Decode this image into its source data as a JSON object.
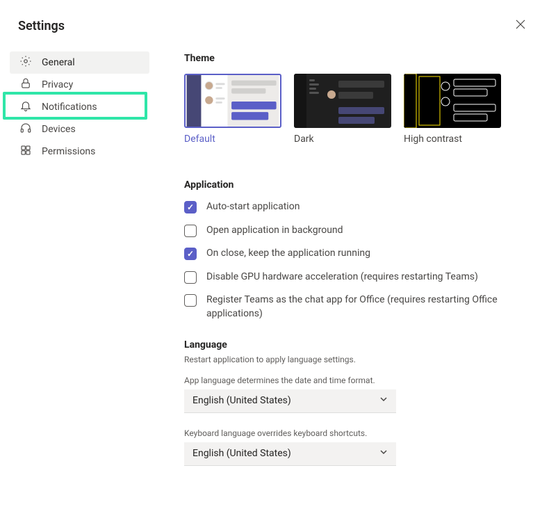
{
  "title": "Settings",
  "sidebar": {
    "items": [
      {
        "label": "General"
      },
      {
        "label": "Privacy"
      },
      {
        "label": "Notifications"
      },
      {
        "label": "Devices"
      },
      {
        "label": "Permissions"
      }
    ]
  },
  "theme": {
    "title": "Theme",
    "options": [
      {
        "label": "Default"
      },
      {
        "label": "Dark"
      },
      {
        "label": "High contrast"
      }
    ]
  },
  "application": {
    "title": "Application",
    "options": [
      {
        "label": "Auto-start application",
        "checked": true
      },
      {
        "label": "Open application in background",
        "checked": false
      },
      {
        "label": "On close, keep the application running",
        "checked": true
      },
      {
        "label": "Disable GPU hardware acceleration (requires restarting Teams)",
        "checked": false
      },
      {
        "label": "Register Teams as the chat app for Office (requires restarting Office applications)",
        "checked": false
      }
    ]
  },
  "language": {
    "title": "Language",
    "restart_hint": "Restart application to apply language settings.",
    "app_lang_hint": "App language determines the date and time format.",
    "app_lang_value": "English (United States)",
    "kb_lang_hint": "Keyboard language overrides keyboard shortcuts.",
    "kb_lang_value": "English (United States)"
  }
}
